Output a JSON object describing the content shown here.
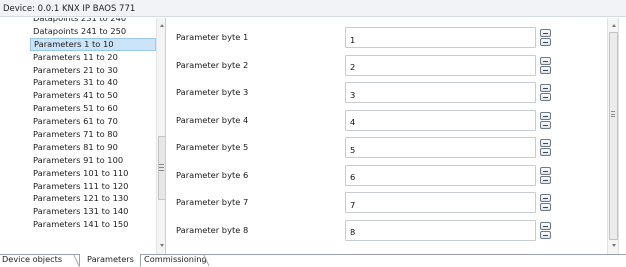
{
  "device_bar": {
    "text": "Device: 0.0.1  KNX IP BAOS 771"
  },
  "tree": {
    "items": [
      {
        "label": "Datapoints 231 to 240",
        "selected": false
      },
      {
        "label": "Datapoints 241 to 250",
        "selected": false
      },
      {
        "label": "Parameters 1 to 10",
        "selected": true
      },
      {
        "label": "Parameters 11 to 20",
        "selected": false
      },
      {
        "label": "Parameters 21 to 30",
        "selected": false
      },
      {
        "label": "Parameters 31 to 40",
        "selected": false
      },
      {
        "label": "Parameters 41 to 50",
        "selected": false
      },
      {
        "label": "Parameters 51 to 60",
        "selected": false
      },
      {
        "label": "Parameters 61 to 70",
        "selected": false
      },
      {
        "label": "Parameters 71 to 80",
        "selected": false
      },
      {
        "label": "Parameters 81 to 90",
        "selected": false
      },
      {
        "label": "Parameters 91 to 100",
        "selected": false
      },
      {
        "label": "Parameters 101 to 110",
        "selected": false
      },
      {
        "label": "Parameters 111 to 120",
        "selected": false
      },
      {
        "label": "Parameters 121 to 130",
        "selected": false
      },
      {
        "label": "Parameters 131 to 140",
        "selected": false
      },
      {
        "label": "Parameters 141 to 150",
        "selected": false
      }
    ]
  },
  "parameters": [
    {
      "label": "Parameter byte 1",
      "value": "1"
    },
    {
      "label": "Parameter byte 2",
      "value": "2"
    },
    {
      "label": "Parameter byte 3",
      "value": "3"
    },
    {
      "label": "Parameter byte 4",
      "value": "4"
    },
    {
      "label": "Parameter byte 5",
      "value": "5"
    },
    {
      "label": "Parameter byte 6",
      "value": "6"
    },
    {
      "label": "Parameter byte 7",
      "value": "7"
    },
    {
      "label": "Parameter byte 8",
      "value": "8"
    }
  ],
  "tabs": [
    {
      "label": "Device objects",
      "active": false
    },
    {
      "label": "Parameters",
      "active": true
    },
    {
      "label": "Commissioning",
      "active": false
    }
  ],
  "colors": {
    "selection_bg": "#cce4f7",
    "selection_border": "#99c9ef",
    "input_border": "#c7ccd3",
    "header_bg": "#f1f3f6"
  }
}
